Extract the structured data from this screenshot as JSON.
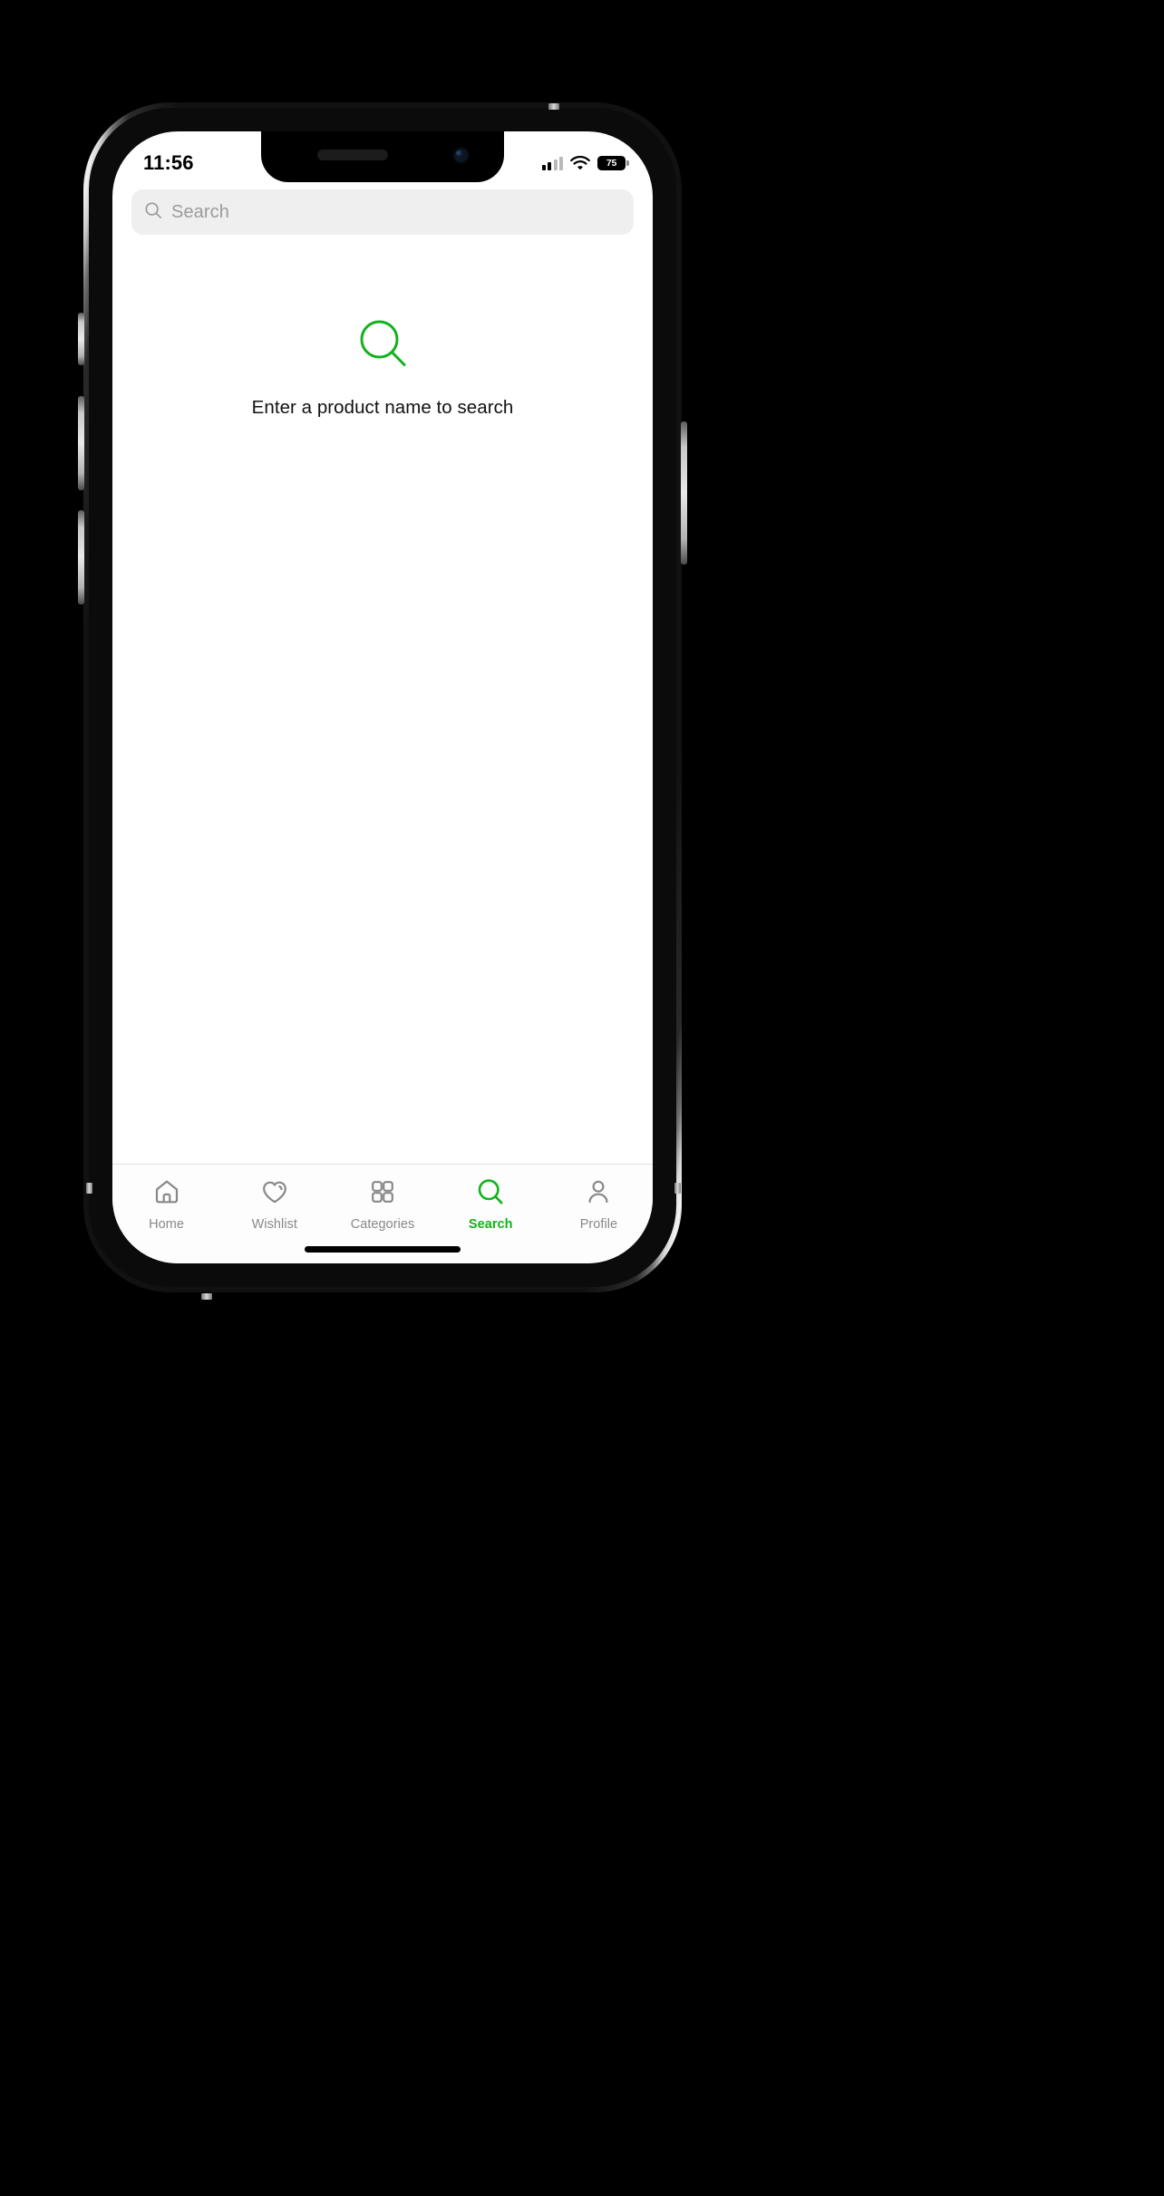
{
  "device": {
    "name": "iphone-mockup",
    "frame_color": "#c8c8c8"
  },
  "status_bar": {
    "time": "11:56",
    "cellular_icon": "cellular-signal-icon",
    "wifi_icon": "wifi-icon",
    "battery_icon": "battery-icon",
    "battery_level": "75"
  },
  "search": {
    "icon": "search-icon",
    "placeholder": "Search",
    "value": ""
  },
  "empty_state": {
    "icon": "search-icon",
    "icon_color": "#13b21c",
    "message": "Enter a product name to search"
  },
  "tabbar": {
    "active_color": "#13b21c",
    "inactive_color": "#888888",
    "items": [
      {
        "label": "Home",
        "icon": "home-icon",
        "active": false
      },
      {
        "label": "Wishlist",
        "icon": "heart-icon",
        "active": false
      },
      {
        "label": "Categories",
        "icon": "grid-icon",
        "active": false
      },
      {
        "label": "Search",
        "icon": "search-icon",
        "active": true
      },
      {
        "label": "Profile",
        "icon": "person-icon",
        "active": false
      }
    ]
  }
}
